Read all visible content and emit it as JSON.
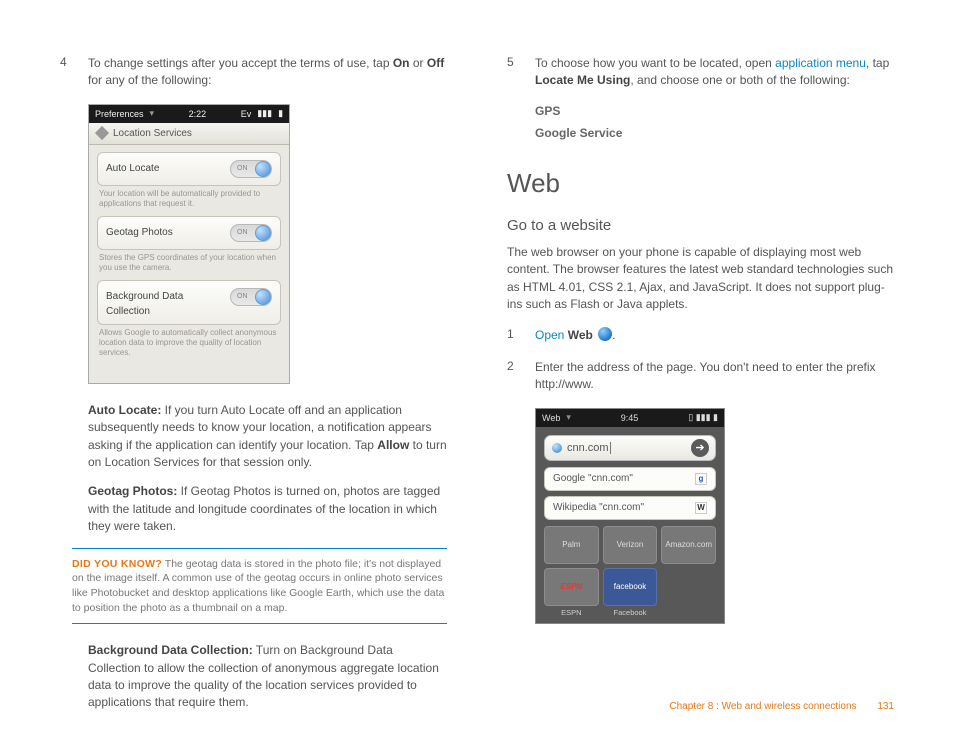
{
  "left": {
    "step4_num": "4",
    "step4_a": "To change settings after you accept the terms of use, tap ",
    "step4_b1": "On",
    "step4_mid": " or ",
    "step4_b2": "Off",
    "step4_c": " for any of the following:",
    "phone1": {
      "status_left": "Preferences",
      "status_time": "2:22",
      "status_ev": "Ev",
      "title": "Location Services",
      "card1": "Auto Locate",
      "toggle_on": "ON",
      "desc1": "Your location will be automatically provided to applications that request it.",
      "card2": "Geotag Photos",
      "desc2": "Stores the GPS coordinates of your location when you use the camera.",
      "card3a": "Background Data",
      "card3b": "Collection",
      "desc3": "Allows Google to automatically collect anonymous location data to improve the quality of location services."
    },
    "auto_label": "Auto Locate:",
    "auto_text_a": " If you turn Auto Locate off and an application subsequently needs to know your location, a notification appears asking if the application can identify your location. Tap ",
    "auto_allow": "Allow",
    "auto_text_b": " to turn on Location Services for that session only.",
    "geo_label": "Geotag Photos:",
    "geo_text": " If Geotag Photos is turned on, photos are tagged with the latitude and longitude coordinates of the location in which they were taken.",
    "tip_label": "DID YOU KNOW?",
    "tip_text": " The geotag data is stored in the photo file; it's not displayed on the image itself. A common use of the geotag occurs in online photo services like Photobucket and desktop applications like Google Earth, which use the data to position the photo as a thumbnail on a map.",
    "bg_label": "Background Data Collection:",
    "bg_text": " Turn on Background Data Collection to allow the collection of anonymous aggregate location data to improve the quality of the location services provided to applications that require them."
  },
  "right": {
    "step5_num": "5",
    "step5_a": "To choose how you want to be located, open ",
    "step5_link": "application menu",
    "step5_b": ", tap ",
    "step5_bold": "Locate Me Using",
    "step5_c": ", and choose one or both of the following:",
    "opt1": "GPS",
    "opt2": "Google Service",
    "h1": "Web",
    "h2": "Go to a website",
    "intro": "The web browser on your phone is capable of displaying most web content. The browser features the latest web standard technologies such as HTML 4.01, CSS 2.1, Ajax, and JavaScript. It does not support plug-ins such as Flash or Java applets.",
    "s1_num": "1",
    "s1_link": "Open",
    "s1_bold": "Web",
    "s1_period": ".",
    "s2_num": "2",
    "s2_text": "Enter the address of the page. You don't need to enter the prefix http://www.",
    "phone2": {
      "status_left": "Web",
      "status_time": "9:45",
      "url": "cnn.com",
      "sugg1": "Google \"cnn.com\"",
      "sugg2": "Wikipedia \"cnn.com\"",
      "g": "g",
      "w": "W",
      "bm1": "Palm",
      "bm2": "Verizon",
      "bm3": "Amazon.com",
      "bm4": "ESPN",
      "bm5": "facebook",
      "lab1": "ESPN",
      "lab2": "Facebook"
    }
  },
  "footer": {
    "chapter": "Chapter 8 : Web and wireless connections",
    "page": "131"
  }
}
